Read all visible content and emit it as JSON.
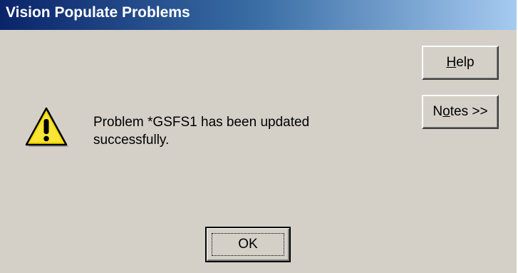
{
  "window": {
    "title": "Vision Populate Problems"
  },
  "buttons": {
    "help": {
      "underlined_char": "H",
      "rest": "elp"
    },
    "notes": {
      "prefix": "N",
      "underlined_char": "o",
      "rest": "tes >>"
    },
    "ok": {
      "label": "OK"
    }
  },
  "message": {
    "line1": "Problem *GSFS1 has been updated",
    "line2": "successfully."
  },
  "icons": {
    "warning": "warning-icon"
  },
  "colors": {
    "face": "#d4d0c8",
    "title_start": "#0a246a",
    "title_end": "#a6caf0",
    "warning_yellow": "#f5d90a"
  }
}
